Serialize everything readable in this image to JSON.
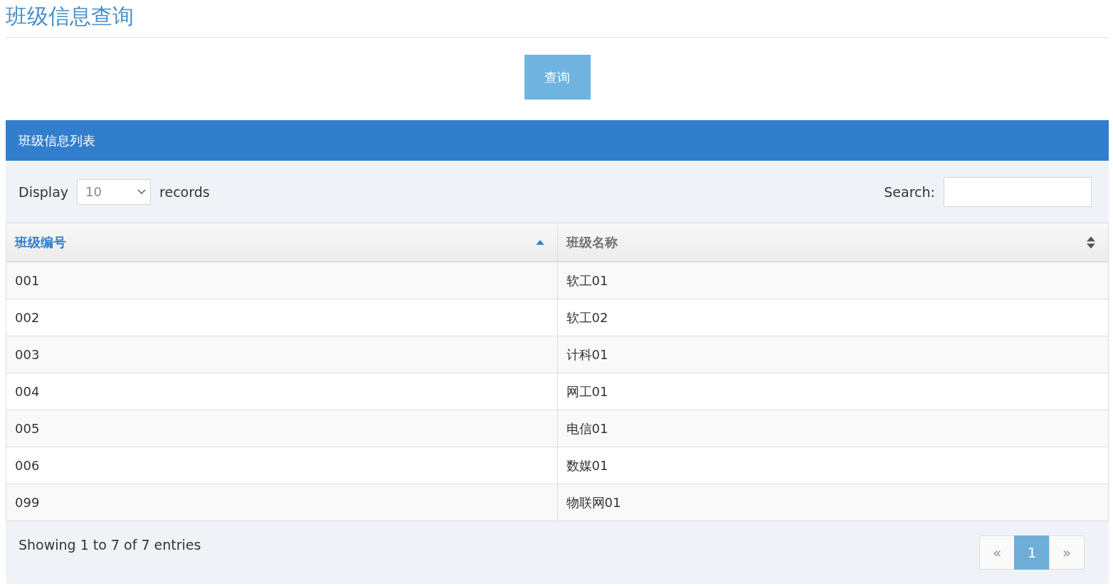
{
  "page_title": "班级信息查询",
  "query_button": "查询",
  "panel": {
    "title": "班级信息列表",
    "length_label_before": "Display",
    "length_value": "10",
    "length_label_after": "records",
    "search_label": "Search:",
    "table": {
      "columns": [
        {
          "label": "班级编号",
          "sorted": true,
          "descending": false
        },
        {
          "label": "班级名称",
          "sorted": false
        }
      ],
      "rows": [
        [
          "001",
          "软工01"
        ],
        [
          "002",
          "软工02"
        ],
        [
          "003",
          "计科01"
        ],
        [
          "004",
          "网工01"
        ],
        [
          "005",
          "电信01"
        ],
        [
          "006",
          "数媒01"
        ],
        [
          "099",
          "物联网01"
        ]
      ]
    },
    "info": "Showing 1 to 7 of 7 entries",
    "pagination": [
      {
        "label": "«",
        "selected": false,
        "disabled": true
      },
      {
        "label": "1",
        "selected": true,
        "disabled": false
      },
      {
        "label": "»",
        "selected": false,
        "disabled": true
      }
    ]
  }
}
